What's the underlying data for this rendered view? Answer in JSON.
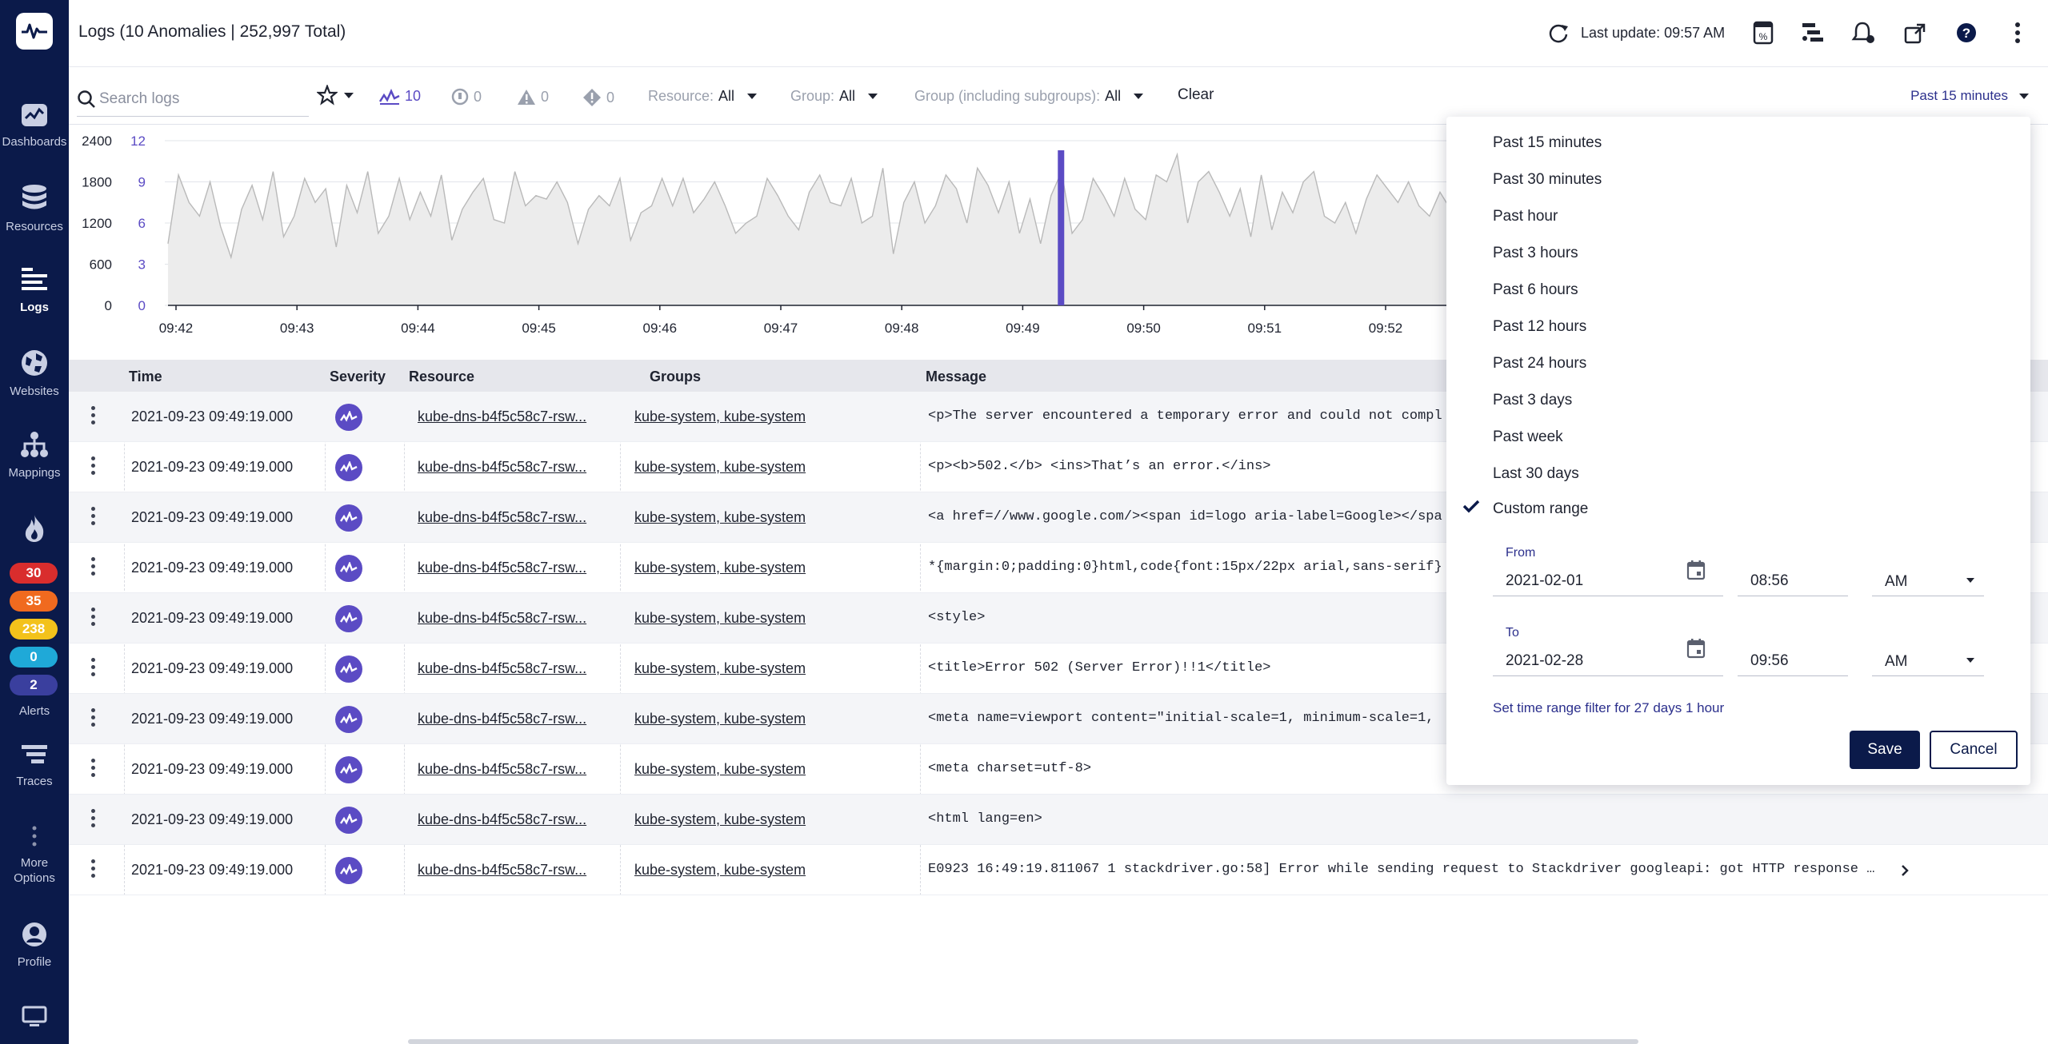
{
  "header": {
    "title": "Logs (10 Anomalies | 252,997 Total)",
    "last_update": "Last update: 09:57 AM"
  },
  "sidebar": {
    "items": [
      {
        "label": "Dashboards",
        "icon": "dashboards-icon"
      },
      {
        "label": "Resources",
        "icon": "database-icon"
      },
      {
        "label": "Logs",
        "icon": "logs-icon"
      },
      {
        "label": "Websites",
        "icon": "globe-icon"
      },
      {
        "label": "Mappings",
        "icon": "topology-icon"
      },
      {
        "label": "Alerts",
        "icon": "flame-icon"
      },
      {
        "label": "Traces",
        "icon": "traces-icon"
      },
      {
        "label": "More Options",
        "icon": "more-icon"
      },
      {
        "label": "Profile",
        "icon": "profile-icon"
      }
    ],
    "alert_counts": [
      {
        "value": "30",
        "color": "#d92d2d"
      },
      {
        "value": "35",
        "color": "#f06a1f"
      },
      {
        "value": "238",
        "color": "#f3c21b"
      },
      {
        "value": "0",
        "color": "#1fa9d8"
      },
      {
        "value": "2",
        "color": "#3a3f9e"
      }
    ]
  },
  "filters": {
    "search_placeholder": "Search logs",
    "anomaly_count": "10",
    "count_a": "0",
    "count_b": "0",
    "count_c": "0",
    "resource_label": "Resource:",
    "resource_value": "All",
    "group_label": "Group:",
    "group_value": "All",
    "subgroup_label": "Group (including subgroups):",
    "subgroup_value": "All",
    "clear": "Clear",
    "time_range": "Past 15 minutes"
  },
  "chart_data": {
    "type": "area",
    "y_left_ticks": [
      "2400",
      "1800",
      "1200",
      "600",
      "0"
    ],
    "y_right_ticks": [
      "12",
      "9",
      "6",
      "3",
      "0"
    ],
    "x_ticks": [
      "09:42",
      "09:43",
      "09:44",
      "09:45",
      "09:46",
      "09:47",
      "09:48",
      "09:49",
      "09:50",
      "09:51",
      "09:52"
    ],
    "ylim": [
      0,
      2400
    ],
    "anomaly_marker_time": "09:49:19",
    "anomaly_count": 10,
    "values": [
      900,
      1900,
      1500,
      1300,
      1800,
      1150,
      700,
      1400,
      1750,
      1250,
      1950,
      1000,
      1300,
      1850,
      1500,
      1700,
      850,
      1750,
      1350,
      1950,
      1050,
      1300,
      1850,
      1250,
      1650,
      1300,
      1900,
      950,
      1400,
      1650,
      1850,
      1250,
      1200,
      1950,
      1450,
      1600,
      1550,
      1800,
      1500,
      900,
      1400,
      1600,
      1450,
      1850,
      950,
      1350,
      1450,
      1850,
      1450,
      1850,
      1350,
      1550,
      1800,
      1450,
      1050,
      1200,
      1300,
      1850,
      1600,
      1300,
      1100,
      1650,
      1900,
      1500,
      1450,
      1850,
      1200,
      1300,
      2000,
      750,
      1500,
      1800,
      1200,
      1450,
      1900,
      1700,
      1200,
      2000,
      1750,
      1350,
      1800,
      1050,
      1550,
      900,
      1600,
      1950,
      1050,
      1250,
      1850,
      1600,
      1300,
      1850,
      1400,
      1250,
      1900,
      1800,
      2200,
      1200,
      1800,
      1950,
      1650,
      1300,
      1700,
      1000,
      1900,
      1100,
      1650,
      1350,
      1800,
      1950,
      1300,
      1200,
      1500,
      1050,
      1550,
      1900,
      1700,
      1500,
      1800,
      1450,
      1300,
      1650,
      1400,
      1950,
      1050,
      1300,
      1900,
      1400,
      1550
    ]
  },
  "table": {
    "columns": [
      "Time",
      "Severity",
      "Resource",
      "Groups",
      "Message"
    ],
    "rows": [
      {
        "time": "2021-09-23 09:49:19.000",
        "resource": "kube-dns-b4f5c58c7-rsw...",
        "groups": "kube-system, kube-system",
        "message": "<p>The server encountered a temporary error and could not compl"
      },
      {
        "time": "2021-09-23 09:49:19.000",
        "resource": "kube-dns-b4f5c58c7-rsw...",
        "groups": "kube-system, kube-system",
        "message": "<p><b>502.</b> <ins>That’s an error.</ins>"
      },
      {
        "time": "2021-09-23 09:49:19.000",
        "resource": "kube-dns-b4f5c58c7-rsw...",
        "groups": "kube-system, kube-system",
        "message": "<a href=//www.google.com/><span id=logo aria-label=Google></spa"
      },
      {
        "time": "2021-09-23 09:49:19.000",
        "resource": "kube-dns-b4f5c58c7-rsw...",
        "groups": "kube-system, kube-system",
        "message": "*{margin:0;padding:0}html,code{font:15px/22px arial,sans-serif}"
      },
      {
        "time": "2021-09-23 09:49:19.000",
        "resource": "kube-dns-b4f5c58c7-rsw...",
        "groups": "kube-system, kube-system",
        "message": "<style>"
      },
      {
        "time": "2021-09-23 09:49:19.000",
        "resource": "kube-dns-b4f5c58c7-rsw...",
        "groups": "kube-system, kube-system",
        "message": "<title>Error 502 (Server Error)!!1</title>"
      },
      {
        "time": "2021-09-23 09:49:19.000",
        "resource": "kube-dns-b4f5c58c7-rsw...",
        "groups": "kube-system, kube-system",
        "message": "<meta name=viewport content=\"initial-scale=1, minimum-scale=1,"
      },
      {
        "time": "2021-09-23 09:49:19.000",
        "resource": "kube-dns-b4f5c58c7-rsw...",
        "groups": "kube-system, kube-system",
        "message": "<meta charset=utf-8>"
      },
      {
        "time": "2021-09-23 09:49:19.000",
        "resource": "kube-dns-b4f5c58c7-rsw...",
        "groups": "kube-system, kube-system",
        "message": "<html lang=en>"
      },
      {
        "time": "2021-09-23 09:49:19.000",
        "resource": "kube-dns-b4f5c58c7-rsw...",
        "groups": "kube-system, kube-system",
        "message": "E0923 16:49:19.811067 1 stackdriver.go:58] Error while sending request to Stackdriver googleapi: got HTTP response …"
      }
    ]
  },
  "time_dropdown": {
    "options": [
      "Past 15 minutes",
      "Past 30 minutes",
      "Past hour",
      "Past 3 hours",
      "Past 6 hours",
      "Past 12 hours",
      "Past 24 hours",
      "Past 3 days",
      "Past week",
      "Last 30 days",
      "Custom range"
    ],
    "selected": "Custom range",
    "from_label": "From",
    "from_date": "2021-02-01",
    "from_time": "08:56",
    "from_ampm": "AM",
    "to_label": "To",
    "to_date": "2021-02-28",
    "to_time": "09:56",
    "to_ampm": "AM",
    "hint": "Set time range filter for 27 days 1 hour",
    "save": "Save",
    "cancel": "Cancel"
  },
  "colors": {
    "sidebar": "#0b1a4a",
    "accent": "#5b4bc4",
    "link": "#2b2f8c"
  }
}
